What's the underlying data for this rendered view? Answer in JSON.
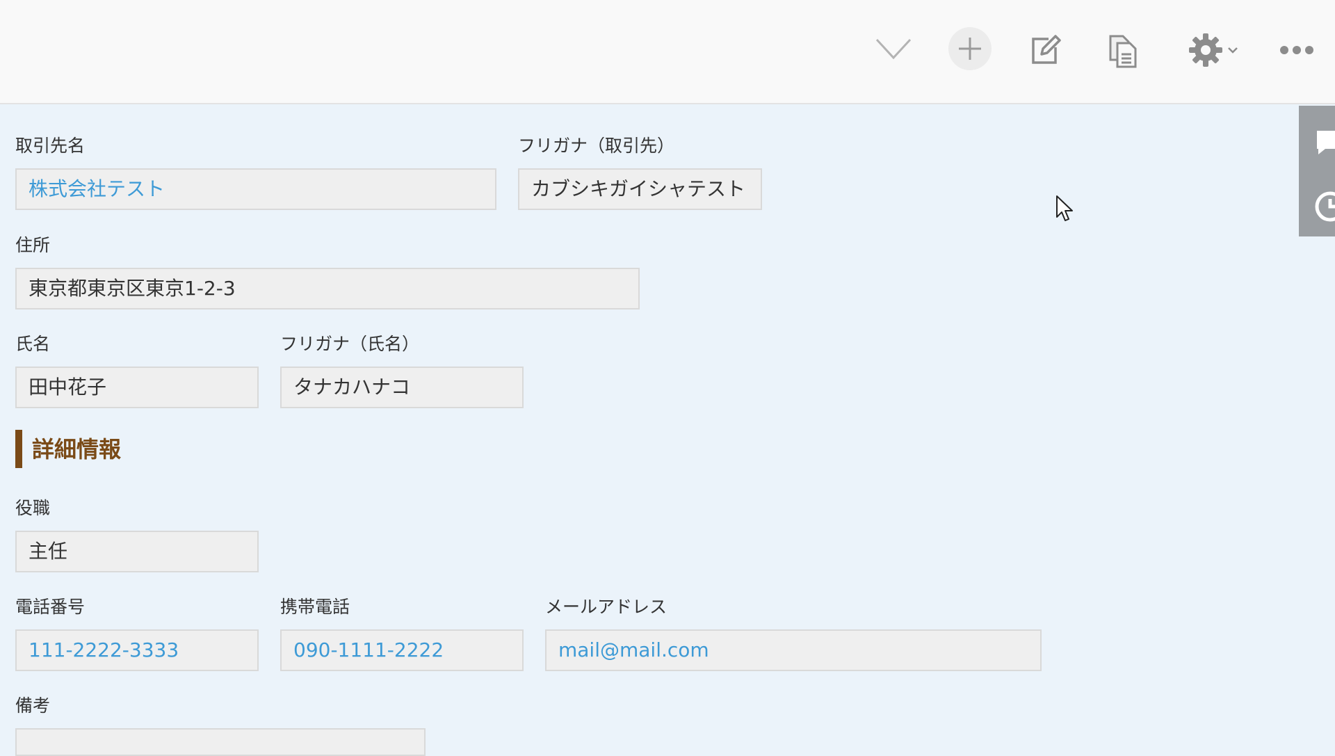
{
  "toolbar": {
    "icons": [
      "chevron-down-icon",
      "plus-icon",
      "edit-icon",
      "copy-icon",
      "gear-icon",
      "chevron-down-icon",
      "more-icon"
    ]
  },
  "form": {
    "company_name": {
      "label": "取引先名",
      "value": "株式会社テスト"
    },
    "company_kana": {
      "label": "フリガナ（取引先）",
      "value": "カブシキガイシャテスト"
    },
    "address": {
      "label": "住所",
      "value": "東京都東京区東京1-2-3"
    },
    "person_name": {
      "label": "氏名",
      "value": "田中花子"
    },
    "person_kana": {
      "label": "フリガナ（氏名）",
      "value": "タナカハナコ"
    },
    "section_title": "詳細情報",
    "job_title": {
      "label": "役職",
      "value": "主任"
    },
    "phone": {
      "label": "電話番号",
      "value": "111-2222-3333"
    },
    "mobile": {
      "label": "携帯電話",
      "value": "090-1111-2222"
    },
    "email": {
      "label": "メールアドレス",
      "value": "mail@mail.com"
    },
    "notes": {
      "label": "備考",
      "value": ""
    }
  },
  "colors": {
    "background": "#ebf3fa",
    "link": "#3d9ad6",
    "section_accent": "#7a4a17",
    "side_panel": "#9a9ea2"
  }
}
